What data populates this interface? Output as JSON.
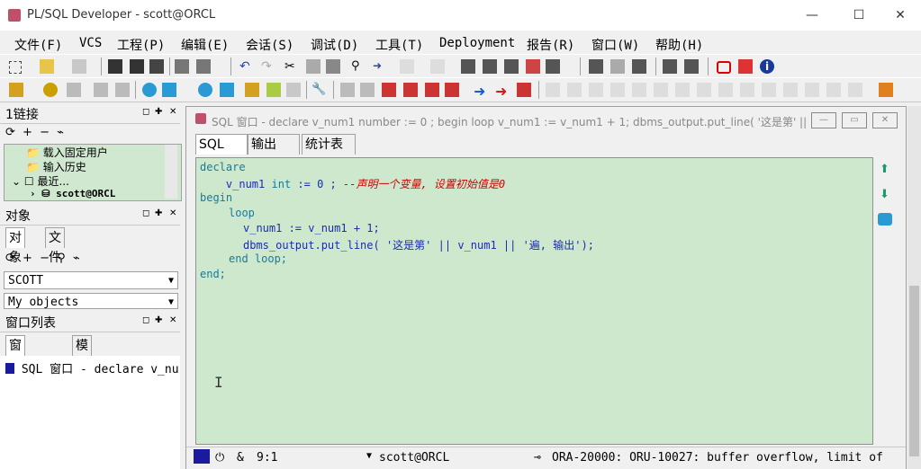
{
  "window": {
    "title": "PL/SQL Developer - scott@ORCL",
    "minimize": "—",
    "maximize": "☐",
    "close": "✕"
  },
  "menu": [
    "文件(F)",
    "VCS",
    "工程(P)",
    "编辑(E)",
    "会话(S)",
    "调试(D)",
    "工具(T)",
    "Deployment",
    "报告(R)",
    "窗口(W)",
    "帮助(H)"
  ],
  "connections": {
    "title": "1链接",
    "tree": [
      "载入固定用户",
      "输入历史",
      "最近...",
      "scott@ORCL"
    ]
  },
  "objects": {
    "title": "对象",
    "tabs": [
      "对象",
      "文件"
    ],
    "user": "SCOTT",
    "filter": "My objects"
  },
  "windowlist": {
    "title": "窗口列表",
    "tabs": [
      "窗口列表",
      "模板"
    ],
    "item": "SQL 窗口 - declare v_nu"
  },
  "sqlwindow": {
    "title": "SQL 窗口 - declare v_num1 number := 0 ; begin loop v_num1 := v_num1 + 1; dbms_output.put_line( '这是第' || v_n...",
    "tabs": [
      "SQL",
      "输出",
      "统计表"
    ],
    "code": {
      "l1": "declare",
      "l2_id": "v_num1",
      "l2_type": "int",
      "l2_assign": ":= 0 ;",
      "l2_comment": "--声明一个变量, 设置初始值是0",
      "l3": "begin",
      "l4": "loop",
      "l5": "v_num1 := v_num1 + 1;",
      "l6_call": "dbms_output.put_line(",
      "l6_s1": "'这是第'",
      "l6_mid": "|| v_num1 ||",
      "l6_s2": "'遍, 输出'",
      "l6_end": ");",
      "l7": "end loop;",
      "l8": "end;"
    },
    "status": {
      "amp": "&",
      "position": "9:1",
      "connection": "scott@ORCL",
      "message": "ORA-20000: ORU-10027: buffer overflow, limit of"
    }
  },
  "colors": {
    "editor_bg": "#cde8cd",
    "keyword": "#1a7a9a",
    "identifier": "#1c2cb3",
    "comment": "#d00000"
  }
}
